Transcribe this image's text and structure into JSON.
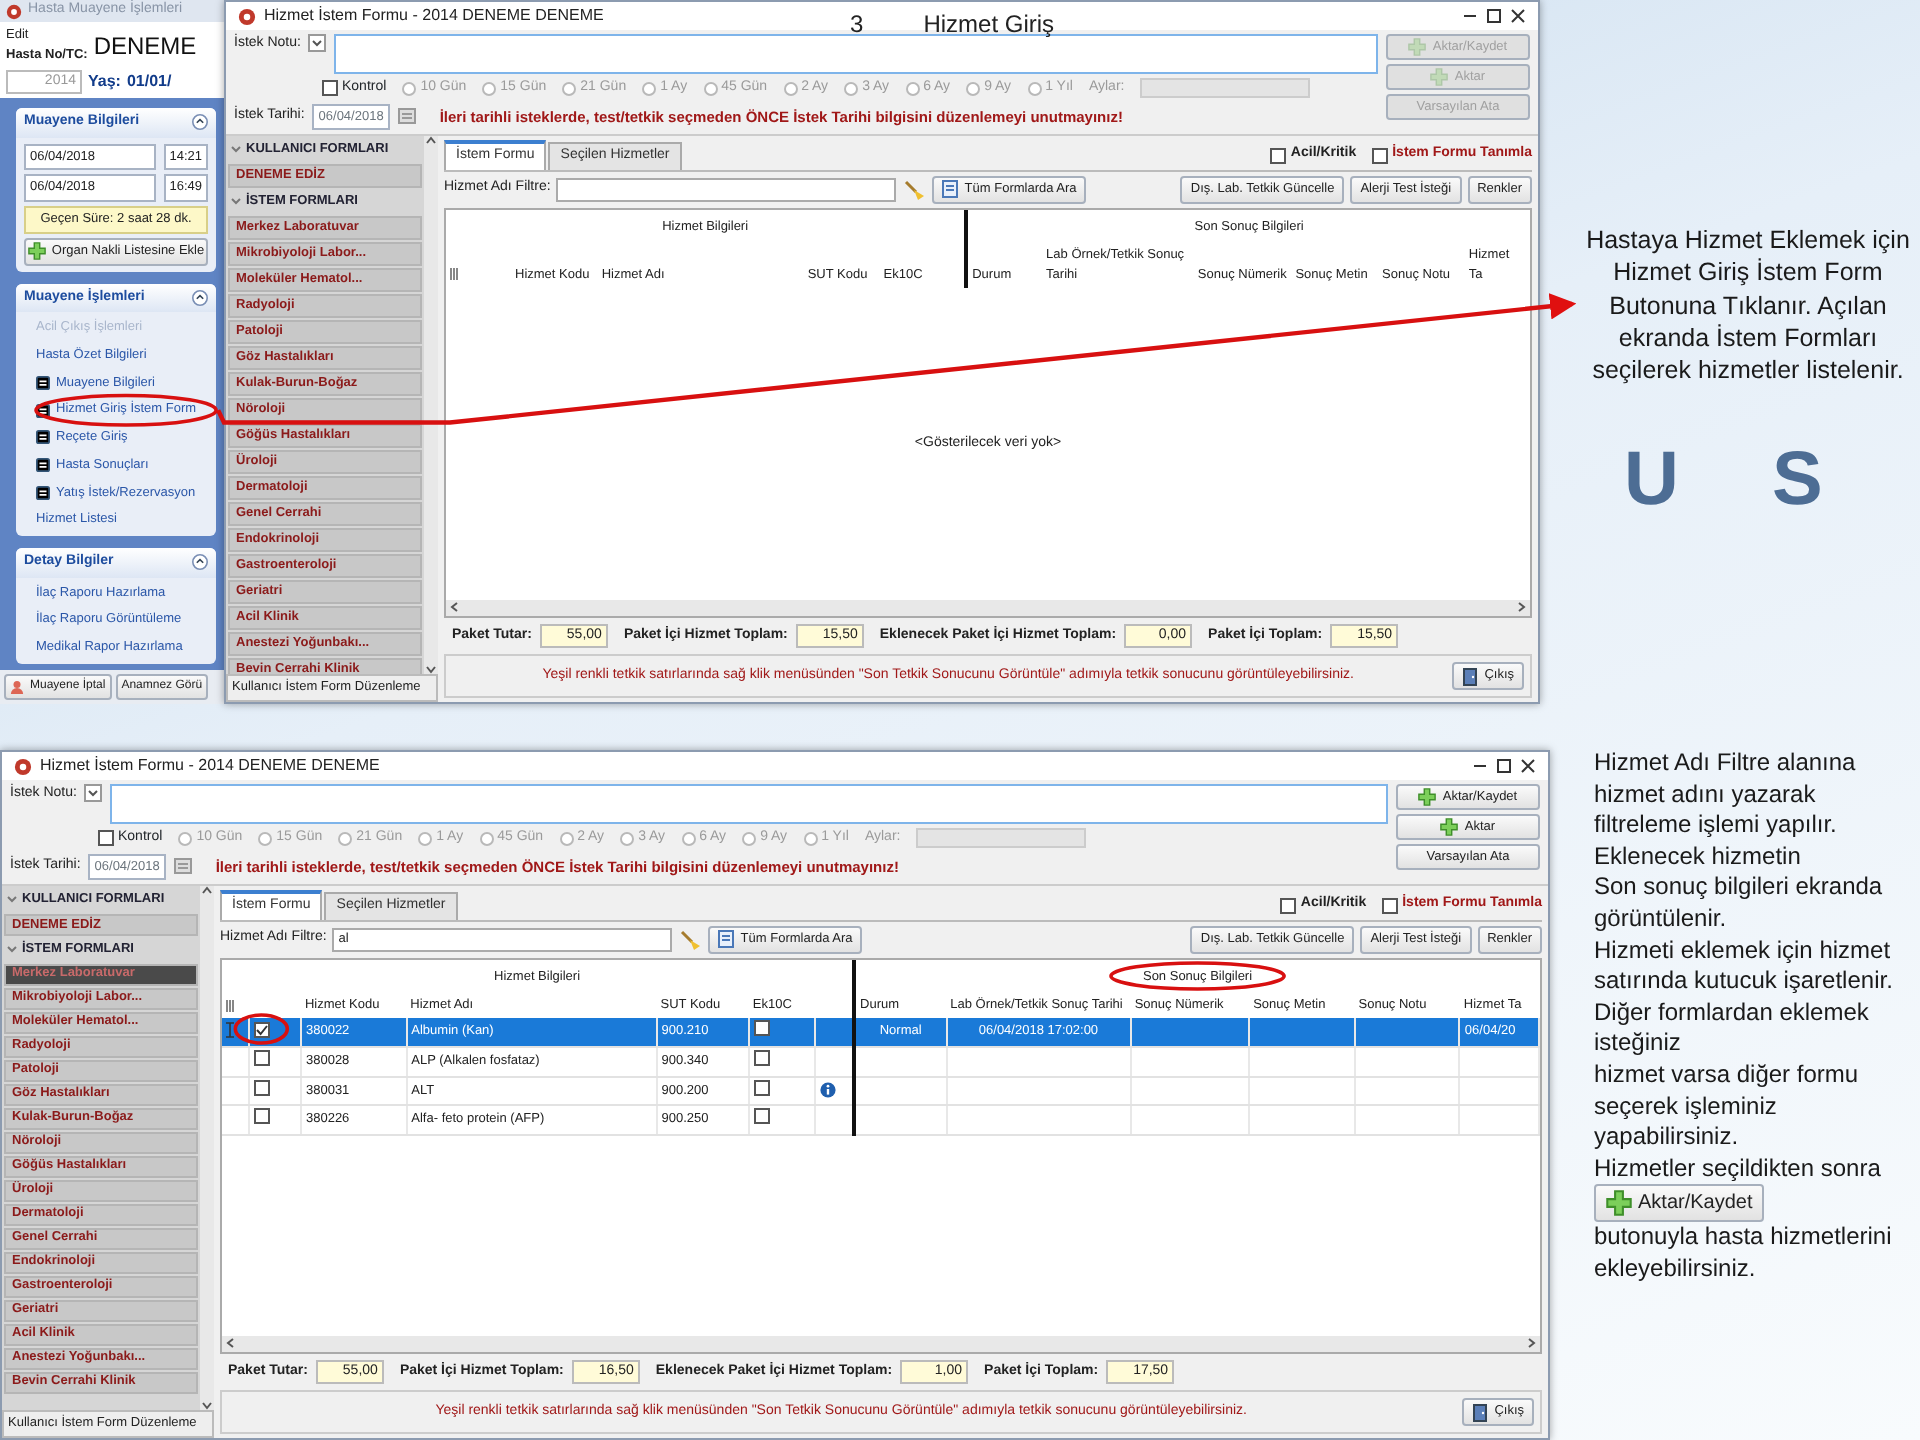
{
  "slide_title": {
    "number": "3",
    "text": "Hizmet Giriş"
  },
  "patient_window": {
    "title": "Hasta Muayene İşlemleri",
    "id_label": "Hasta No/TC:",
    "edit_label": "Edit",
    "patient_no": "2014",
    "patient_name": "DENEME",
    "age_label": "Yaş:",
    "age_value": "01/01/",
    "panels": [
      {
        "kind": "visit",
        "title": "Muayene Bilgileri",
        "times": [
          {
            "date": "06/04/2018",
            "time": "14:21"
          },
          {
            "date": "06/04/2018",
            "time": "16:49"
          }
        ],
        "elapsed": "Geçen Süre: 2 saat 28 dk.",
        "action": "Organ Nakli Listesine Ekle"
      },
      {
        "kind": "links",
        "title": "Muayene İşlemleri",
        "items": [
          {
            "label": "Acil Çıkış İşlemleri",
            "disabled": true,
            "icon": false,
            "highlighted": false
          },
          {
            "label": "Hasta Özet Bilgileri",
            "disabled": false,
            "icon": false,
            "highlighted": false
          },
          {
            "label": "Muayene Bilgileri",
            "disabled": false,
            "icon": true,
            "highlighted": false
          },
          {
            "label": "Hizmet Giriş İstem Form",
            "disabled": false,
            "icon": true,
            "highlighted": true
          },
          {
            "label": "Reçete Giriş",
            "disabled": false,
            "icon": true,
            "highlighted": false
          },
          {
            "label": "Hasta Sonuçları",
            "disabled": false,
            "icon": true,
            "highlighted": false
          },
          {
            "label": "Yatış İstek/Rezervasyon",
            "disabled": false,
            "icon": true,
            "highlighted": false
          },
          {
            "label": "Hizmet Listesi",
            "disabled": false,
            "icon": false,
            "highlighted": false
          }
        ]
      },
      {
        "kind": "links",
        "title": "Detay Bilgiler",
        "items": [
          {
            "label": "İlaç Raporu Hazırlama",
            "disabled": false,
            "icon": false,
            "highlighted": false
          },
          {
            "label": "İlaç Raporu Görüntüleme",
            "disabled": false,
            "icon": false,
            "highlighted": false
          },
          {
            "label": "Medikal Rapor Hazırlama",
            "disabled": false,
            "icon": false,
            "highlighted": false
          }
        ]
      }
    ],
    "buttons": [
      "Muayene İptal",
      "Anamnez Görü"
    ]
  },
  "form_windows": [
    {
      "title": "Hizmet İstem Formu - 2014 DENEME DENEME",
      "note_label": "İstek Notu:",
      "kontrol": {
        "label": "Kontrol",
        "checked": false
      },
      "periods": [
        {
          "label": "10 Gün",
          "selected": false
        },
        {
          "label": "15 Gün",
          "selected": false
        },
        {
          "label": "21 Gün",
          "selected": false
        },
        {
          "label": "1 Ay",
          "selected": false
        },
        {
          "label": "45 Gün",
          "selected": false
        },
        {
          "label": "2 Ay",
          "selected": false
        },
        {
          "label": "3 Ay",
          "selected": false
        },
        {
          "label": "6 Ay",
          "selected": false
        },
        {
          "label": "9 Ay",
          "selected": false
        },
        {
          "label": "1 Yıl",
          "selected": false
        }
      ],
      "months_label": "Aylar:",
      "date_label": "İstek Tarihi:",
      "date_value": "06/04/2018",
      "warning": "İleri tarihli isteklerde, test/tetkik seçmeden ÖNCE İstek Tarihi bilgisini düzenlemeyi unutmayınız!",
      "action_buttons": [
        {
          "label": "Aktar/Kaydet",
          "kind": "add",
          "disabled": true
        },
        {
          "label": "Aktar",
          "kind": "add",
          "disabled": true
        },
        {
          "label": "Varsayılan Ata",
          "kind": "plain",
          "disabled": true
        }
      ],
      "form_groups": [
        {
          "title": "KULLANICI FORMLARI",
          "items": [
            {
              "label": "DENEME EDİZ",
              "selected": false
            }
          ]
        },
        {
          "title": "İSTEM FORMLARI",
          "items": [
            {
              "label": "Merkez Laboratuvar",
              "selected": false
            },
            {
              "label": "Mikrobiyoloji Labor...",
              "selected": false
            },
            {
              "label": "Moleküler Hematol...",
              "selected": false
            },
            {
              "label": "Radyoloji",
              "selected": false
            },
            {
              "label": "Patoloji",
              "selected": false
            },
            {
              "label": "Göz Hastalıkları",
              "selected": false
            },
            {
              "label": "Kulak-Burun-Boğaz",
              "selected": false
            },
            {
              "label": "Nöroloji",
              "selected": false
            },
            {
              "label": "Göğüs Hastalıkları",
              "selected": false
            },
            {
              "label": "Üroloji",
              "selected": false
            },
            {
              "label": "Dermatoloji",
              "selected": false
            },
            {
              "label": "Genel Cerrahi",
              "selected": false
            },
            {
              "label": "Endokrinoloji",
              "selected": false
            },
            {
              "label": "Gastroenteroloji",
              "selected": false
            },
            {
              "label": "Geriatri",
              "selected": false
            },
            {
              "label": "Acil Klinik",
              "selected": false
            },
            {
              "label": "Anestezi Yoğunbakı...",
              "selected": false
            },
            {
              "label": "Bevin Cerrahi Klinik",
              "selected": false
            }
          ]
        }
      ],
      "form_edit_button": "Kullanıcı İstem Form Düzenleme",
      "tabs": [
        {
          "label": "İstem Formu",
          "selected": true
        },
        {
          "label": "Seçilen Hizmetler",
          "selected": false
        }
      ],
      "flags": [
        {
          "label": "Acil/Kritik",
          "checked": false
        },
        {
          "label": "İstem Formu Tanımla",
          "checked": false
        }
      ],
      "filter_label": "Hizmet Adı Filtre:",
      "search_all_button": "Tüm Formlarda Ara",
      "toolbar_buttons": [
        "Dış. Lab. Tetkik Güncelle",
        "Alerji Test İsteği",
        "Renkler"
      ],
      "grid": {
        "groups": [
          {
            "label": "Hizmet Bilgileri",
            "highlighted": false
          },
          {
            "label": "Son Sonuç Bilgileri",
            "highlighted": false
          }
        ],
        "columns": [
          "Hizmet Kodu",
          "Hizmet Adı",
          "SUT Kodu",
          "Ek10C",
          "Durum",
          "Lab Örnek/Tetkik Sonuç Tarihi",
          "Sonuç Nümerik",
          "Sonuç Metin",
          "Sonuç Notu",
          "Hizmet Ta"
        ],
        "empty_text": "<Gösterilecek veri yok>"
      },
      "totals": [
        {
          "label": "Paket Tutar:",
          "value": "55,00"
        },
        {
          "label": "Paket İçi Hizmet Toplam:",
          "value": "15,50"
        },
        {
          "label": "Eklenecek Paket İçi Hizmet Toplam:",
          "value": "0,00"
        },
        {
          "label": "Paket İçi Toplam:",
          "value": "15,50"
        }
      ],
      "footer_note": "Yeşil renkli tetkik satırlarında sağ klik menüsünden \"Son Tetkik Sonucunu Görüntüle\" adımıyla tetkik sonucunu görüntüleyebilirsiniz.",
      "exit_button": "Çıkış"
    },
    {
      "title": "Hizmet İstem Formu - 2014 DENEME DENEME",
      "note_label": "İstek Notu:",
      "kontrol": {
        "label": "Kontrol",
        "checked": false
      },
      "periods": [
        {
          "label": "10 Gün",
          "selected": false
        },
        {
          "label": "15 Gün",
          "selected": false
        },
        {
          "label": "21 Gün",
          "selected": false
        },
        {
          "label": "1 Ay",
          "selected": false
        },
        {
          "label": "45 Gün",
          "selected": false
        },
        {
          "label": "2 Ay",
          "selected": false
        },
        {
          "label": "3 Ay",
          "selected": false
        },
        {
          "label": "6 Ay",
          "selected": false
        },
        {
          "label": "9 Ay",
          "selected": false
        },
        {
          "label": "1 Yıl",
          "selected": false
        }
      ],
      "months_label": "Aylar:",
      "date_label": "İstek Tarihi:",
      "date_value": "06/04/2018",
      "warning": "İleri tarihli isteklerde, test/tetkik seçmeden ÖNCE İstek Tarihi bilgisini düzenlemeyi unutmayınız!",
      "action_buttons": [
        {
          "label": "Aktar/Kaydet",
          "kind": "add",
          "disabled": false
        },
        {
          "label": "Aktar",
          "kind": "add",
          "disabled": false
        },
        {
          "label": "Varsayılan Ata",
          "kind": "plain",
          "disabled": false
        }
      ],
      "form_groups": [
        {
          "title": "KULLANICI FORMLARI",
          "items": [
            {
              "label": "DENEME EDİZ",
              "selected": false
            }
          ]
        },
        {
          "title": "İSTEM FORMLARI",
          "items": [
            {
              "label": "Merkez Laboratuvar",
              "selected": true
            },
            {
              "label": "Mikrobiyoloji Labor...",
              "selected": false
            },
            {
              "label": "Moleküler Hematol...",
              "selected": false
            },
            {
              "label": "Radyoloji",
              "selected": false
            },
            {
              "label": "Patoloji",
              "selected": false
            },
            {
              "label": "Göz Hastalıkları",
              "selected": false
            },
            {
              "label": "Kulak-Burun-Boğaz",
              "selected": false
            },
            {
              "label": "Nöroloji",
              "selected": false
            },
            {
              "label": "Göğüs Hastalıkları",
              "selected": false
            },
            {
              "label": "Üroloji",
              "selected": false
            },
            {
              "label": "Dermatoloji",
              "selected": false
            },
            {
              "label": "Genel Cerrahi",
              "selected": false
            },
            {
              "label": "Endokrinoloji",
              "selected": false
            },
            {
              "label": "Gastroenteroloji",
              "selected": false
            },
            {
              "label": "Geriatri",
              "selected": false
            },
            {
              "label": "Acil Klinik",
              "selected": false
            },
            {
              "label": "Anestezi Yoğunbakı...",
              "selected": false
            },
            {
              "label": "Bevin Cerrahi Klinik",
              "selected": false
            }
          ]
        }
      ],
      "form_edit_button": "Kullanıcı İstem Form Düzenleme",
      "tabs": [
        {
          "label": "İstem Formu",
          "selected": true
        },
        {
          "label": "Seçilen Hizmetler",
          "selected": false
        }
      ],
      "flags": [
        {
          "label": "Acil/Kritik",
          "checked": false
        },
        {
          "label": "İstem Formu Tanımla",
          "checked": false
        }
      ],
      "filter_label": "Hizmet Adı Filtre:",
      "filter_value": "al",
      "search_all_button": "Tüm Formlarda Ara",
      "toolbar_buttons": [
        "Dış. Lab. Tetkik Güncelle",
        "Alerji Test İsteği",
        "Renkler"
      ],
      "grid": {
        "groups": [
          {
            "label": "Hizmet Bilgileri",
            "highlighted": false
          },
          {
            "label": "Son Sonuç Bilgileri",
            "highlighted": true
          }
        ],
        "columns": [
          "Hizmet Kodu",
          "Hizmet Adı",
          "SUT Kodu",
          "Ek10C",
          "Durum",
          "Lab Örnek/Tetkik Sonuç Tarihi",
          "Sonuç Nümerik",
          "Sonuç Metin",
          "Sonuç Notu",
          "Hizmet Ta"
        ],
        "rows": [
          {
            "selected": true,
            "checked": true,
            "highlighted": true,
            "code": "380022",
            "name": "Albumin (Kan)",
            "sut": "900.210",
            "ek10c": false,
            "info": false,
            "status": "Normal",
            "result_date": "06/04/2018 17:02:00",
            "service_date": "06/04/20"
          },
          {
            "selected": false,
            "checked": false,
            "highlighted": false,
            "code": "380028",
            "name": "ALP (Alkalen fosfataz)",
            "sut": "900.340",
            "ek10c": false,
            "info": false
          },
          {
            "selected": false,
            "checked": false,
            "highlighted": false,
            "code": "380031",
            "name": "ALT",
            "sut": "900.200",
            "ek10c": false,
            "info": true
          },
          {
            "selected": false,
            "checked": false,
            "highlighted": false,
            "code": "380226",
            "name": "Alfa- feto protein (AFP)",
            "sut": "900.250",
            "ek10c": false,
            "info": false
          }
        ]
      },
      "totals": [
        {
          "label": "Paket Tutar:",
          "value": "55,00"
        },
        {
          "label": "Paket İçi Hizmet Toplam:",
          "value": "16,50"
        },
        {
          "label": "Eklenecek Paket İçi Hizmet Toplam:",
          "value": "1,00"
        },
        {
          "label": "Paket İçi Toplam:",
          "value": "17,50"
        }
      ],
      "footer_note": "Yeşil renkli tetkik satırlarında sağ klik menüsünden \"Son Tetkik Sonucunu Görüntüle\" adımıyla tetkik sonucunu görüntüleyebilirsiniz.",
      "exit_button": "Çıkış"
    }
  ],
  "logo_text": "U S",
  "notes": [
    {
      "paragraphs": [
        "Hastaya Hizmet Eklemek için Hizmet Giriş İstem Form Butonuna Tıklanır. Açılan ekranda İstem Formları seçilerek hizmetler listelenir."
      ]
    },
    {
      "paragraphs": [
        "Hizmet Adı Filtre alanına hizmet adını yazarak filtreleme işlemi yapılır. Eklenecek hizmetin",
        "Son sonuç bilgileri ekranda görüntülenir.",
        "Hizmeti eklemek için hizmet satırında kutucuk işaretlenir.  Diğer formlardan eklemek isteğiniz",
        "hizmet varsa diğer formu seçerek işleminiz yapabilirsiniz."
      ],
      "closing": {
        "before": "Hizmetler seçildikten sonra",
        "button": "Aktar/Kaydet",
        "after": "butonuyla hasta hizmetlerini ekleyebilirsiniz."
      }
    }
  ]
}
